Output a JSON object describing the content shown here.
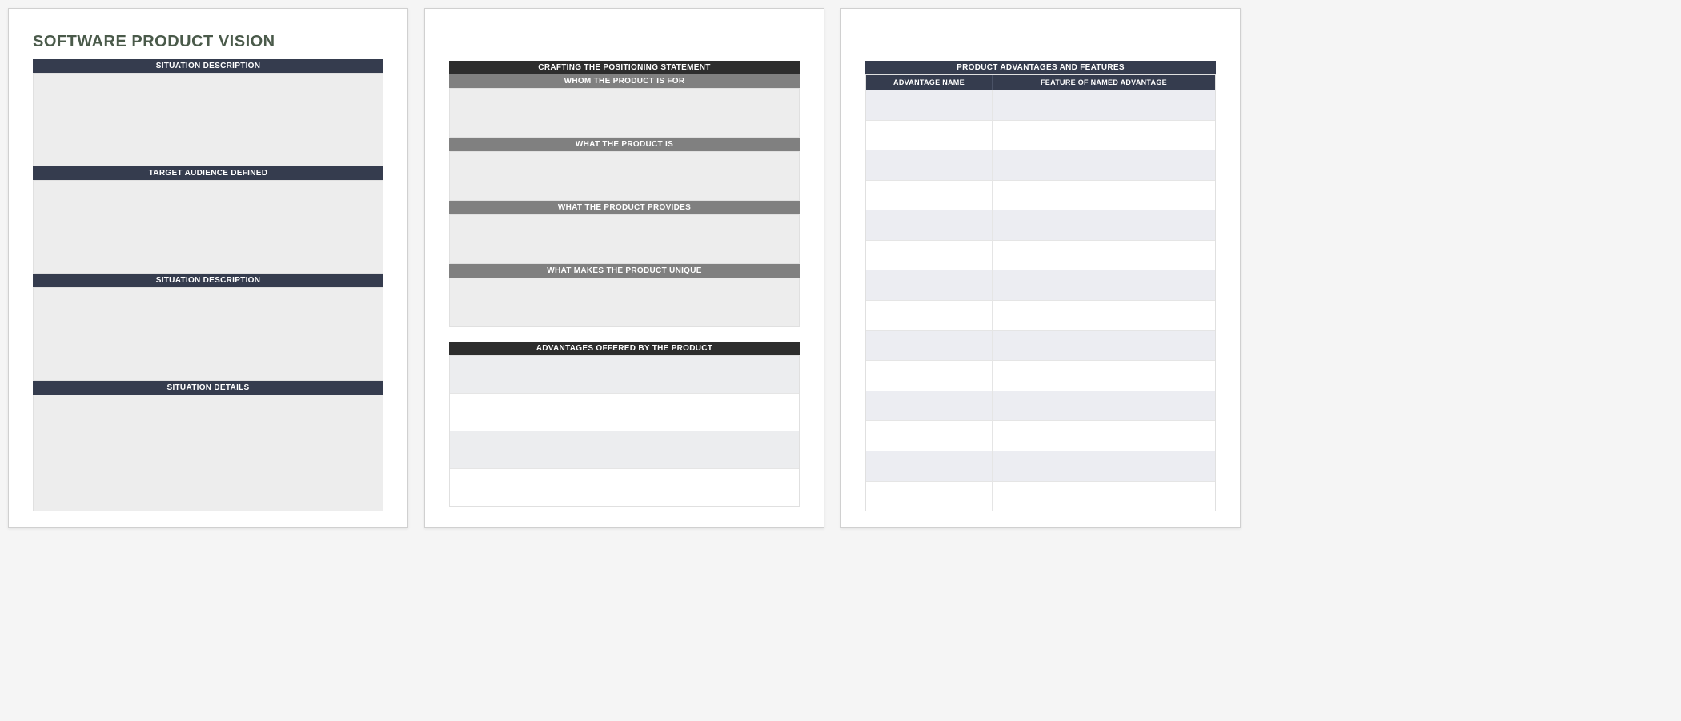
{
  "page1": {
    "title": "SOFTWARE PRODUCT VISION",
    "sections": {
      "situation_desc1": "SITUATION DESCRIPTION",
      "target_audience": "TARGET AUDIENCE DEFINED",
      "situation_desc2": "SITUATION DESCRIPTION",
      "situation_details": "SITUATION DETAILS"
    }
  },
  "page2": {
    "positioning_title": "CRAFTING THE POSITIONING STATEMENT",
    "whom_for": "WHOM THE PRODUCT IS FOR",
    "what_is": "WHAT THE PRODUCT IS",
    "provides": "WHAT THE PRODUCT PROVIDES",
    "unique": "WHAT MAKES THE PRODUCT UNIQUE",
    "advantages_title": "ADVANTAGES OFFERED BY THE PRODUCT"
  },
  "page3": {
    "title": "PRODUCT ADVANTAGES AND FEATURES",
    "col_advantage": "ADVANTAGE NAME",
    "col_feature": "FEATURE OF NAMED ADVANTAGE"
  }
}
